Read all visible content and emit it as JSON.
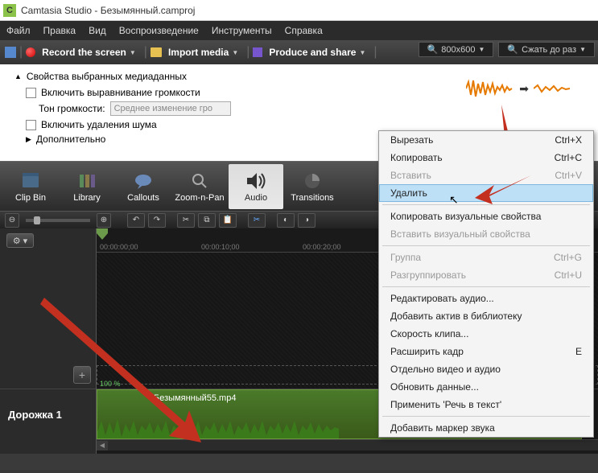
{
  "titlebar": {
    "app": "Camtasia Studio",
    "project": "Безымянный.camproj",
    "logo_letter": "C"
  },
  "menubar": [
    "Файл",
    "Правка",
    "Вид",
    "Воспроизведение",
    "Инструменты",
    "Справка"
  ],
  "toolbar": {
    "record": "Record the screen",
    "import": "Import media",
    "produce": "Produce and share"
  },
  "right_toolbar": {
    "dimensions": "800x600",
    "shrink": "Сжать до раз"
  },
  "props": {
    "title": "Свойства выбранных медиаданных",
    "volume_leveling": "Включить выравнивание громкости",
    "tone_label": "Тон громкости:",
    "tone_value": "Среднее изменение гро",
    "noise_removal": "Включить удаления шума",
    "advanced": "Дополнительно"
  },
  "tool_tabs": [
    {
      "label": "Clip Bin",
      "id": "clip-bin"
    },
    {
      "label": "Library",
      "id": "library"
    },
    {
      "label": "Callouts",
      "id": "callouts"
    },
    {
      "label": "Zoom-n-Pan",
      "id": "zoom-n-pan"
    },
    {
      "label": "Audio",
      "id": "audio"
    },
    {
      "label": "Transitions",
      "id": "transitions"
    }
  ],
  "timeline": {
    "ruler_times": [
      "00:00:00;00",
      "00:00:10;00",
      "00:00:20;00"
    ],
    "track1_label": "Дорожка 1",
    "clip_name": "Безымянный55.mp4",
    "clip_percent": "100 %"
  },
  "context_menu": {
    "groups": [
      [
        {
          "label": "Вырезать",
          "shortcut": "Ctrl+X",
          "disabled": false
        },
        {
          "label": "Копировать",
          "shortcut": "Ctrl+C",
          "disabled": false
        },
        {
          "label": "Вставить",
          "shortcut": "Ctrl+V",
          "disabled": true
        },
        {
          "label": "Удалить",
          "shortcut": "",
          "disabled": false,
          "highlight": true
        }
      ],
      [
        {
          "label": "Копировать визуальные свойства",
          "shortcut": "",
          "disabled": false
        },
        {
          "label": "Вставить визуальный свойства",
          "shortcut": "",
          "disabled": true
        }
      ],
      [
        {
          "label": "Группа",
          "shortcut": "Ctrl+G",
          "disabled": true
        },
        {
          "label": "Разгруппировать",
          "shortcut": "Ctrl+U",
          "disabled": true
        }
      ],
      [
        {
          "label": "Редактировать аудио...",
          "shortcut": "",
          "disabled": false
        },
        {
          "label": "Добавить актив в библиотеку",
          "shortcut": "",
          "disabled": false
        },
        {
          "label": "Скорость клипа...",
          "shortcut": "",
          "disabled": false
        },
        {
          "label": "Расширить кадр",
          "shortcut": "E",
          "disabled": false
        },
        {
          "label": "Отдельно видео и аудио",
          "shortcut": "",
          "disabled": false
        },
        {
          "label": "Обновить данные...",
          "shortcut": "",
          "disabled": false
        },
        {
          "label": "Применить 'Речь в текст'",
          "shortcut": "",
          "disabled": false
        }
      ],
      [
        {
          "label": "Добавить маркер звука",
          "shortcut": "",
          "disabled": false
        }
      ]
    ]
  }
}
